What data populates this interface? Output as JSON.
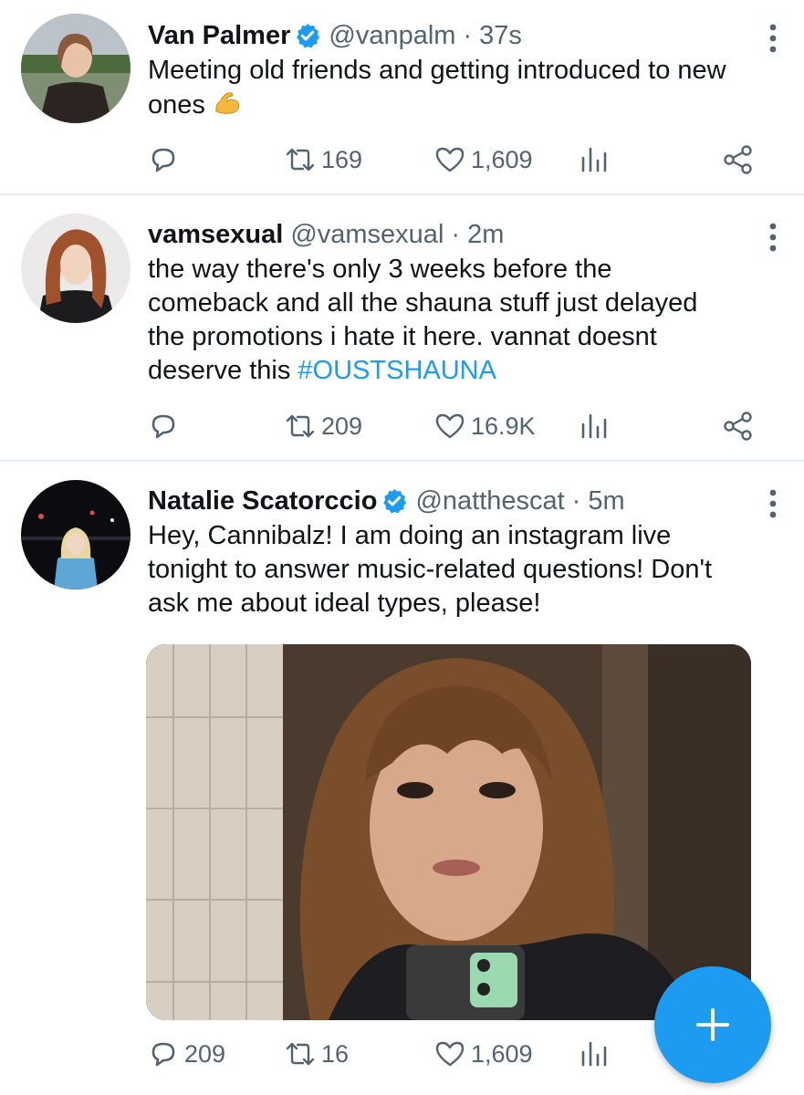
{
  "tweets": [
    {
      "name": "Van Palmer",
      "verified": true,
      "handle": "@vanpalm",
      "separator": "·",
      "time": "37s",
      "text": "Meeting old friends and getting introduced to new ones",
      "emoji": "flexed-biceps-icon",
      "retweets": "169",
      "likes": "1,609",
      "replies": ""
    },
    {
      "name": "vamsexual",
      "verified": false,
      "handle": "@vamsexual",
      "separator": "·",
      "time": "2m",
      "text_line1": "the way there's only 3 weeks before the",
      "text_line2": "comeback and all the shauna stuff just delayed",
      "text_line3": "the promotions i hate it here. vannat doesnt",
      "text_line4_prefix": "deserve this ",
      "hashtag": "#OUSTSHAUNA",
      "retweets": "209",
      "likes": "16.9K",
      "replies": ""
    },
    {
      "name": "Natalie Scatorccio",
      "verified": true,
      "handle": "@natthescat",
      "separator": "·",
      "time": "5m",
      "text_line1": "Hey, Cannibalz! I am doing an instagram live",
      "text_line2": "tonight to answer music-related questions! Don't",
      "text_line3": "ask me about ideal types, please!",
      "replies": "209",
      "retweets": "16",
      "likes": "1,609"
    }
  ],
  "colors": {
    "accent": "#1d9bf0",
    "text": "#0f1419",
    "secondary": "#536471",
    "divider": "#e6ecf0"
  },
  "icons": {
    "reply": "reply-icon",
    "retweet": "retweet-icon",
    "like": "heart-icon",
    "analytics": "analytics-icon",
    "share": "share-icon",
    "more": "more-vertical-icon",
    "compose": "plus-icon"
  }
}
